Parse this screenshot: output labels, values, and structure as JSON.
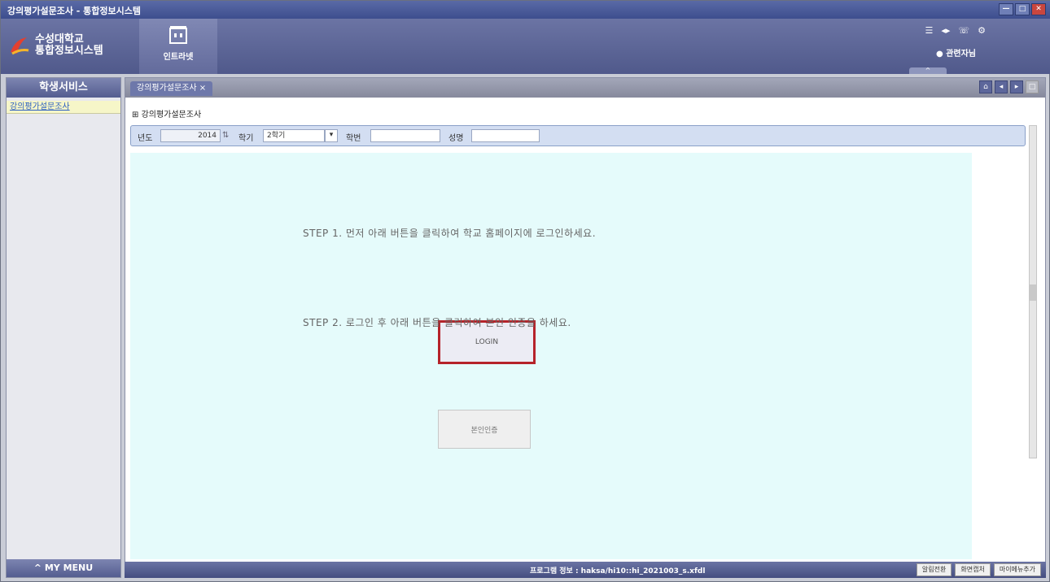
{
  "window": {
    "title": "강의평가설문조사 - 통합정보시스템",
    "controls": [
      "—",
      "□",
      "✕"
    ]
  },
  "header": {
    "logo_line1": "수성대학교",
    "logo_line2": "통합정보시스템",
    "nav_tile_label": "인트라넷",
    "right_icons": [
      "☰",
      "◂▸",
      "☏",
      "⚙"
    ],
    "user_name": "관련자님",
    "collapse_symbol": "^"
  },
  "sidebar": {
    "title": "학생서비스",
    "items": [
      {
        "label": "강의평가설문조사"
      }
    ],
    "footer": "^ MY MENU"
  },
  "tabs": {
    "active_tab": "강의평가설문조사 ×",
    "tool_icons": [
      "⌂",
      "◂",
      "▸",
      "□"
    ]
  },
  "main": {
    "page_title": "강의평가설문조사",
    "filter": {
      "year_label": "년도",
      "year_value": "2014",
      "term_label": "학기",
      "term_value": "2학기",
      "student_id_label": "학번",
      "student_id_value": "",
      "name_label": "성명",
      "name_value": ""
    },
    "step1_text": "STEP 1. 먼저 아래 버튼을 클릭하여 학교 홈페이지에 로그인하세요.",
    "login_button": "LOGIN",
    "step2_text": "STEP 2. 로그인 후 아래 버튼을 클릭하여 본인 인증을 하세요.",
    "verify_button": "본인인증"
  },
  "statusbar": {
    "program_info": "프로그램 정보 : haksa/hi10::hi_2021003_s.xfdl",
    "buttons": [
      "알림전환",
      "화면캡처",
      "마이메뉴추가"
    ]
  },
  "colors": {
    "accent": "#5a6aa6",
    "highlight_border": "#b5232a",
    "content_bg": "#e5fbfb"
  }
}
